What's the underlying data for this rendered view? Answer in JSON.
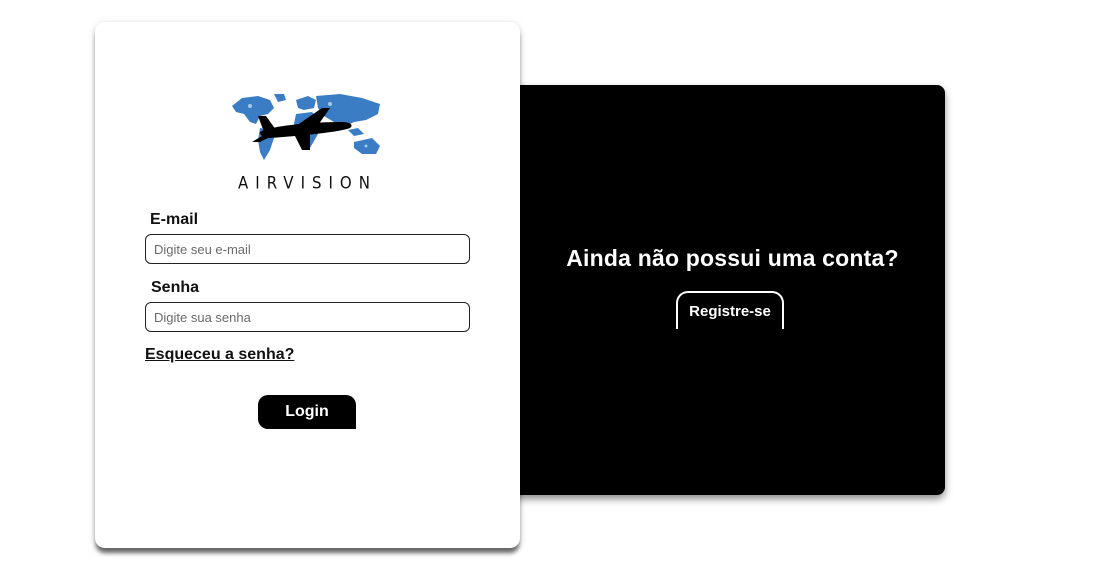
{
  "brand": {
    "name": "AIRVISION",
    "logo_icon": "airplane-world-map-icon"
  },
  "login_form": {
    "email_label": "E-mail",
    "email_placeholder": "Digite seu e-mail",
    "email_value": "",
    "password_label": "Senha",
    "password_placeholder": "Digite sua senha",
    "password_value": "",
    "forgot_link": "Esqueceu a senha?",
    "login_button": "Login"
  },
  "register_panel": {
    "title": "Ainda não possui uma conta?",
    "register_button": "Registre-se"
  },
  "colors": {
    "panel_bg": "#000000",
    "map_blue": "#3a7dc4",
    "text": "#111111"
  }
}
